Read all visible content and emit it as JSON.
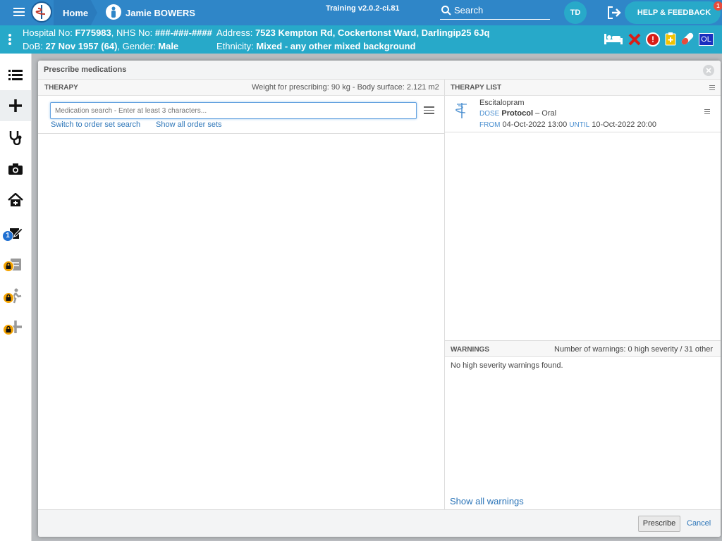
{
  "topbar": {
    "home_label": "Home",
    "patient_name": "Jamie BOWERS",
    "env_label": "Training v2.0.2-ci.81",
    "search_label": "Search",
    "user_initials": "TD",
    "help_label": "HELP & FEEDBACK",
    "help_badge": "1"
  },
  "patient": {
    "hospital_no_label": "Hospital No:",
    "hospital_no": "F775983",
    "nhs_no_label": ", NHS No:",
    "nhs_no": "###-###-####",
    "address_label": "Address:",
    "address": "7523 Kempton Rd, Cockertonst Ward, Darlingip25 6Jq",
    "dob_label": "DoB:",
    "dob": "27 Nov 1957 (64)",
    "gender_label": ", Gender:",
    "gender": "Male",
    "ethnicity_label": "Ethnicity:",
    "ethnicity": "Mixed - any other mixed background",
    "badge_ol": "OL"
  },
  "sidebar": {
    "notif_count": "1"
  },
  "modal": {
    "title": "Prescribe medications",
    "therapy_header": "THERAPY",
    "weight_text": "Weight for prescribing: 90 kg - Body surface: 2.121 m2",
    "search_placeholder": "Medication search - Enter at least 3 characters...",
    "switch_link": "Switch to order set search",
    "show_sets_link": "Show all order sets",
    "therapy_list_header": "THERAPY LIST",
    "therapy_item": {
      "name": "Escitalopram",
      "dose_label": "DOSE",
      "dose_value": "Protocol",
      "route": "– Oral",
      "from_label": "FROM",
      "from_value": "04-Oct-2022 13:00",
      "until_label": "UNTIL",
      "until_value": "10-Oct-2022 20:00"
    },
    "warnings_header": "WARNINGS",
    "warnings_count": "Number of warnings: 0 high severity / 31 other",
    "warnings_text": "No high severity warnings found.",
    "show_all_warnings": "Show all warnings",
    "prescribe_button": "Prescribe",
    "cancel_button": "Cancel"
  }
}
